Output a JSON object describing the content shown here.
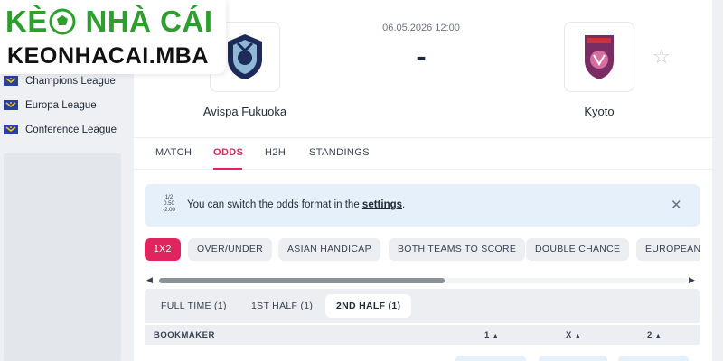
{
  "brand": {
    "logo_top_left": "KÈ",
    "logo_top_right": "NHÀ CÁI",
    "logo_bottom": "KEONHACAI.MBA"
  },
  "sidebar": {
    "items": [
      {
        "label": "Champions League",
        "icon": "european-flag-icon"
      },
      {
        "label": "Europa League",
        "icon": "european-flag-icon"
      },
      {
        "label": "Conference League",
        "icon": "european-flag-icon"
      }
    ]
  },
  "match": {
    "date": "06.05.2026 12:00",
    "score": "-",
    "home": {
      "name": "Avispa Fukuoka",
      "icon": "avispa-fukuoka-crest-icon"
    },
    "away": {
      "name": "Kyoto",
      "icon": "kyoto-sanga-crest-icon"
    },
    "favorite_icon": "star-icon"
  },
  "tabs": [
    {
      "label": "MATCH",
      "active": false
    },
    {
      "label": "ODDS",
      "active": true
    },
    {
      "label": "H2H",
      "active": false
    },
    {
      "label": "STANDINGS",
      "active": false
    }
  ],
  "info_banner": {
    "icon_lines": [
      "1/2",
      "0.50",
      "-2.00"
    ],
    "text_before": "You can switch the odds format in the ",
    "link": "settings",
    "text_after": ".",
    "close_icon": "close-icon"
  },
  "markets": [
    {
      "label": "1X2",
      "active": true
    },
    {
      "label": "OVER/UNDER",
      "active": false
    },
    {
      "label": "ASIAN HANDICAP",
      "active": false
    },
    {
      "label": "BOTH TEAMS TO SCORE",
      "active": false
    },
    {
      "label": "DOUBLE CHANCE",
      "active": false
    },
    {
      "label": "EUROPEAN",
      "active": false
    }
  ],
  "periods": [
    {
      "label": "FULL TIME (1)",
      "active": false
    },
    {
      "label": "1ST HALF (1)",
      "active": false
    },
    {
      "label": "2ND HALF (1)",
      "active": true
    }
  ],
  "table": {
    "bookmaker": "BOOKMAKER",
    "col1": "1",
    "colx": "X",
    "col2": "2",
    "sort_glyph": "▲"
  },
  "colors": {
    "accent": "#e0245e",
    "brand_green": "#2f9e2f",
    "banner_bg": "#e6f0fa"
  }
}
